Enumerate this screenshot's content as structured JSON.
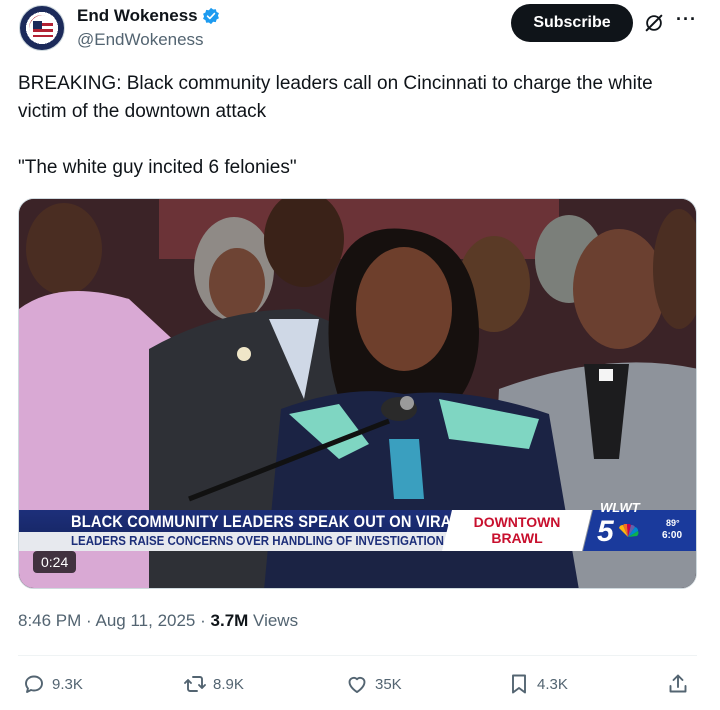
{
  "author": {
    "name": "End Wokeness",
    "handle": "@EndWokeness",
    "avatar_ring_text": "SUPPORT OUR FOUNDING FATHERS"
  },
  "header": {
    "subscribe_label": "Subscribe",
    "grok_icon": "grok-icon",
    "more_label": "···"
  },
  "post": {
    "line1": "BREAKING: Black community leaders call on Cincinnati to charge the white victim of the downtown attack",
    "line2": "\"The white guy incited 6 felonies\""
  },
  "video": {
    "chyron_title": "BLACK COMMUNITY LEADERS SPEAK OUT ON VIRAL BRAWL",
    "chyron_sub": "LEADERS RAISE CONCERNS OVER HANDLING OF INVESTIGATION",
    "tag_line1": "DOWNTOWN",
    "tag_line2": "BRAWL",
    "station": "WLWT",
    "channel": "5",
    "temperature": "89°",
    "time": "6:00",
    "duration": "0:24"
  },
  "meta": {
    "time": "8:46 PM",
    "date": "Aug 11, 2025",
    "views": "3.7M",
    "views_label": "Views"
  },
  "actions": {
    "replies": "9.3K",
    "reposts": "8.9K",
    "likes": "35K",
    "bookmarks": "4.3K"
  },
  "colors": {
    "accent": "#1d9bf0",
    "text": "#0f1419",
    "secondary": "#536471",
    "chyron_blue": "#1d2f7a",
    "chyron_red": "#c8102e"
  }
}
